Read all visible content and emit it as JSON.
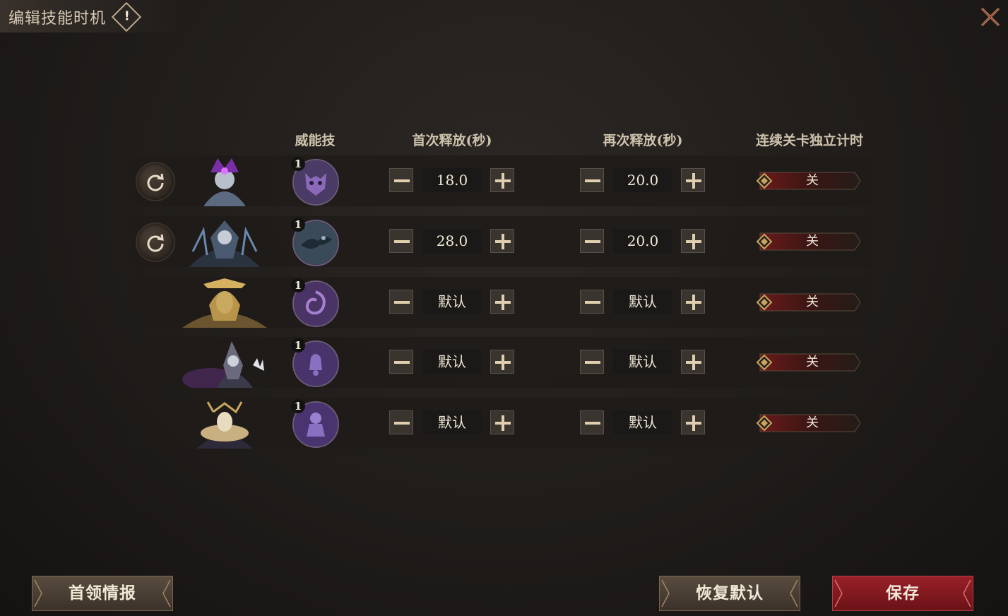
{
  "window": {
    "title": "编辑技能时机",
    "info_icon": "!"
  },
  "columns": {
    "skill": "威能技",
    "first_release": "首次释放(秒)",
    "next_release": "再次释放(秒)",
    "independent_timer": "连续关卡独立计时"
  },
  "rows": [
    {
      "has_reset": true,
      "skill_level": "1",
      "first": "18.0",
      "next": "20.0",
      "toggle": "关",
      "portrait": "purple-horned-boss",
      "skill_icon": "demon-face-icon"
    },
    {
      "has_reset": true,
      "skill_level": "1",
      "first": "28.0",
      "next": "20.0",
      "toggle": "关",
      "portrait": "dark-armored-knight",
      "skill_icon": "shadow-dragon-icon"
    },
    {
      "has_reset": false,
      "skill_level": "1",
      "first": "默认",
      "next": "默认",
      "toggle": "关",
      "portrait": "golden-pharaoh",
      "skill_icon": "swirl-mask-icon"
    },
    {
      "has_reset": false,
      "skill_level": "1",
      "first": "默认",
      "next": "默认",
      "toggle": "关",
      "portrait": "silver-clawed-warrior",
      "skill_icon": "bell-icon"
    },
    {
      "has_reset": false,
      "skill_level": "1",
      "first": "默认",
      "next": "默认",
      "toggle": "关",
      "portrait": "masked-jester",
      "skill_icon": "idol-icon"
    }
  ],
  "buttons": {
    "boss_info": "首领情报",
    "restore_default": "恢复默认",
    "save": "保存"
  },
  "colors": {
    "accent_red": "#8a1c22",
    "gold": "#c9a45c",
    "text": "#e8dcc6"
  }
}
